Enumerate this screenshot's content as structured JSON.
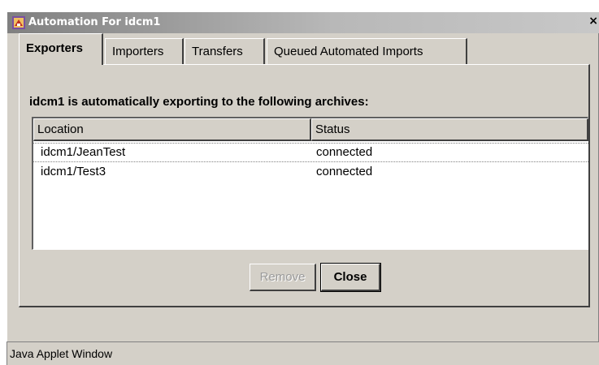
{
  "window": {
    "title": "Automation For idcm1",
    "close_glyph": "×",
    "app_icon": "java-applet-icon"
  },
  "tabs": [
    {
      "label": "Exporters",
      "active": true
    },
    {
      "label": "Importers",
      "active": false
    },
    {
      "label": "Transfers",
      "active": false
    },
    {
      "label": "Queued Automated Imports",
      "active": false
    }
  ],
  "panel": {
    "heading": "idcm1 is automatically exporting to the following archives:"
  },
  "table": {
    "columns": [
      "Location",
      "Status"
    ],
    "rows": [
      {
        "location": "idcm1/JeanTest",
        "status": "connected"
      },
      {
        "location": "idcm1/Test3",
        "status": "connected"
      }
    ]
  },
  "buttons": {
    "remove_label": "Remove",
    "close_label": "Close"
  },
  "status_bar": {
    "text": "Java Applet Window"
  },
  "colors": {
    "face": "#d4d0c8",
    "title_gradient_start": "#808080",
    "disabled_text": "#9a9a9a"
  }
}
